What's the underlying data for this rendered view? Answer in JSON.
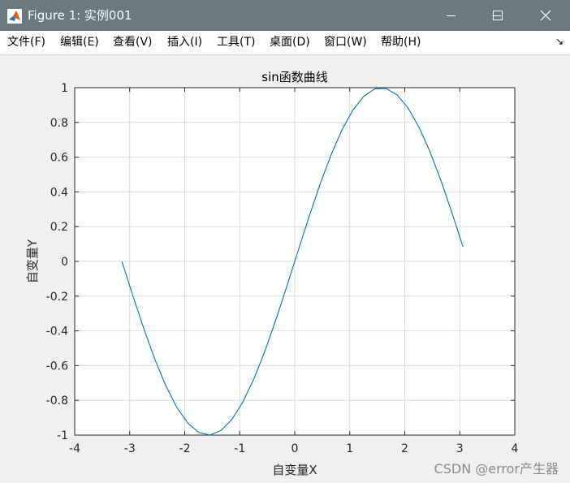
{
  "window": {
    "title": "Figure 1: 实例001"
  },
  "menu": {
    "items": [
      "文件(F)",
      "编辑(E)",
      "查看(V)",
      "插入(I)",
      "工具(T)",
      "桌面(D)",
      "窗口(W)",
      "帮助(H)"
    ]
  },
  "icons": {
    "app": "matlab-logo-icon",
    "minimize": "minimize-icon",
    "maximize": "maximize-icon",
    "close": "close-icon",
    "menu_overflow": "menu-overflow-arrow-icon"
  },
  "chart_data": {
    "type": "line",
    "title": "sin函数曲线",
    "xlabel": "自变量X",
    "ylabel": "自变量Y",
    "xlim": [
      -4,
      4
    ],
    "ylim": [
      -1,
      1
    ],
    "xticks": [
      -4,
      -3,
      -2,
      -1,
      0,
      1,
      2,
      3,
      4
    ],
    "yticks": [
      -1,
      -0.8,
      -0.6,
      -0.4,
      -0.2,
      0,
      0.2,
      0.4,
      0.6,
      0.8,
      1
    ],
    "grid": true,
    "line_color": "#0072bd",
    "series": [
      {
        "x": [
          -3.1416,
          -2.9416,
          -2.7416,
          -2.5416,
          -2.3416,
          -2.1416,
          -1.9416,
          -1.7416,
          -1.5416,
          -1.3416,
          -1.1416,
          -0.9416,
          -0.7416,
          -0.5416,
          -0.3416,
          -0.1416,
          0.0584,
          0.2584,
          0.4584,
          0.6584,
          0.8584,
          1.0584,
          1.2584,
          1.4584,
          1.6584,
          1.8584,
          2.0584,
          2.2584,
          2.4584,
          2.6584,
          2.8584,
          3.0584,
          3.0584
        ],
        "y": [
          0,
          -0.1987,
          -0.3894,
          -0.5646,
          -0.7174,
          -0.8415,
          -0.932,
          -0.9854,
          -0.9996,
          -0.9738,
          -0.9093,
          -0.8085,
          -0.6755,
          -0.5155,
          -0.335,
          -0.1411,
          0.0584,
          0.2555,
          0.4425,
          0.6119,
          0.7568,
          0.8716,
          0.9516,
          0.9937,
          0.9962,
          0.9589,
          0.8835,
          0.7728,
          0.6313,
          0.4646,
          0.2794,
          0.0831,
          0.0831
        ]
      }
    ]
  },
  "watermark": "CSDN @error产生器"
}
